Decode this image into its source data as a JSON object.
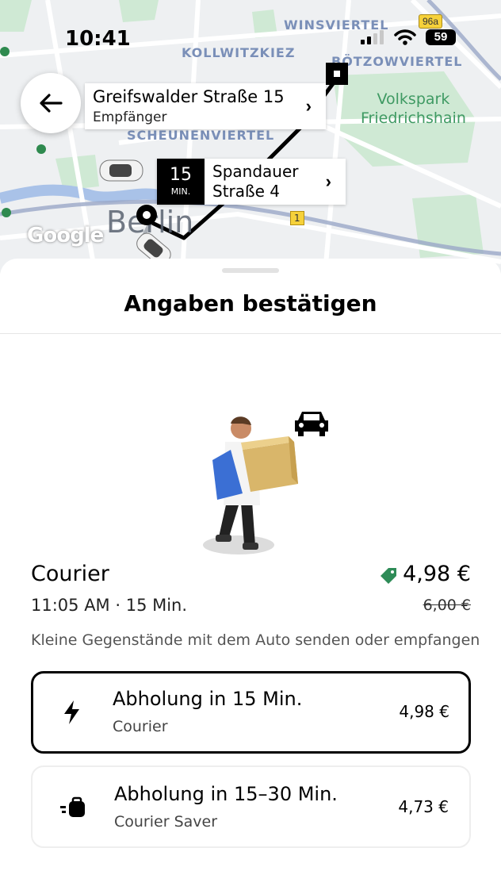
{
  "status_bar": {
    "time": "10:41",
    "battery": "59",
    "battery_badge": "96a"
  },
  "map": {
    "districts": [
      "WINSVIERTEL",
      "KOLLWITZKIEZ",
      "BÖTZOWVIERTEL",
      "SCHEUNENVIERTEL"
    ],
    "park": "Volkspark\nFriedrichshain",
    "city": "Berlin",
    "attribution": "Google",
    "road_badges": [
      "1"
    ],
    "destination": {
      "address": "Greifswalder Straße 15",
      "role": "Empfänger"
    },
    "pickup": {
      "eta_number": "15",
      "eta_unit": "MIN.",
      "address": "Spandauer\nStraße 4"
    },
    "back_icon": "arrow-left-icon"
  },
  "sheet": {
    "title": "Angaben bestätigen",
    "service": {
      "name": "Courier",
      "arrival": "11:05 AM · 15 Min.",
      "price": "4,98 €",
      "old_price": "6,00 €",
      "description": "Kleine Gegenstände mit dem Auto senden oder empfangen"
    },
    "options": [
      {
        "title": "Abholung in 15 Min.",
        "subtitle": "Courier",
        "price": "4,98 €",
        "icon": "lightning-icon",
        "selected": true
      },
      {
        "title": "Abholung in 15–30 Min.",
        "subtitle": "Courier Saver",
        "price": "4,73 €",
        "icon": "saver-bag-icon",
        "selected": false
      }
    ]
  },
  "colors": {
    "accent_green": "#2e8b57",
    "park_green": "#cfe9d4",
    "route": "#000000"
  }
}
